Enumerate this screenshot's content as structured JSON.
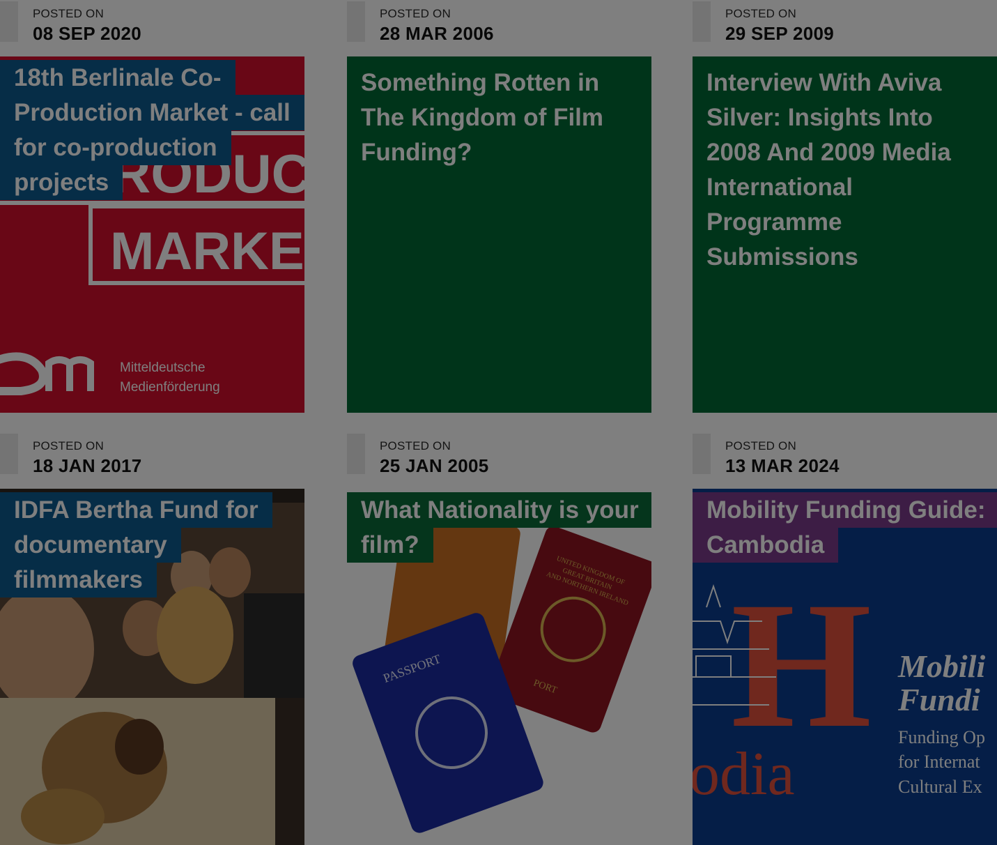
{
  "posts": [
    {
      "label": "POSTED ON",
      "date": "08 SEP 2020",
      "title": "18th Berlinale Co-Production Market - call for co-production projects",
      "image_text": {
        "line1": "RODUCT",
        "line2": "MARKET",
        "brand1": "Mitteldeutsche",
        "brand2": "Medienförderung"
      }
    },
    {
      "label": "POSTED ON",
      "date": "28 MAR 2006",
      "title": "Something Rotten in The Kingdom of Film Funding?"
    },
    {
      "label": "POSTED ON",
      "date": "29 SEP 2009",
      "title": "Interview With Aviva Silver: Insights Into 2008 And 2009 Media International Programme Submissions"
    },
    {
      "label": "POSTED ON",
      "date": "18 JAN 2017",
      "title": "IDFA Bertha Fund for documentary filmmakers"
    },
    {
      "label": "POSTED ON",
      "date": "25 JAN 2005",
      "title": "What Nationality is your film?",
      "image_text": {
        "passport": "PASSPORT",
        "uk1": "UNITED KINGDOM OF",
        "uk2": "GREAT BRITAIN",
        "uk3": "AND NORTHERN IRELAND",
        "uk4": "PORT"
      }
    },
    {
      "label": "POSTED ON",
      "date": "13 MAR 2024",
      "title": "Mobility Funding Guide: Cambodia",
      "image_text": {
        "big_letter": "H",
        "country": "odia",
        "headline1": "Mobili",
        "headline2": "Fundi",
        "sub1": "Funding Op",
        "sub2": "for Internat",
        "sub3": "Cultural Ex"
      }
    }
  ],
  "colors": {
    "red": "#d20f2c",
    "green": "#006935",
    "navy": "#0a3d8f",
    "label_blue": "#0d5a8f",
    "label_green": "#0b6a38",
    "label_purple": "#7a3a8a"
  }
}
